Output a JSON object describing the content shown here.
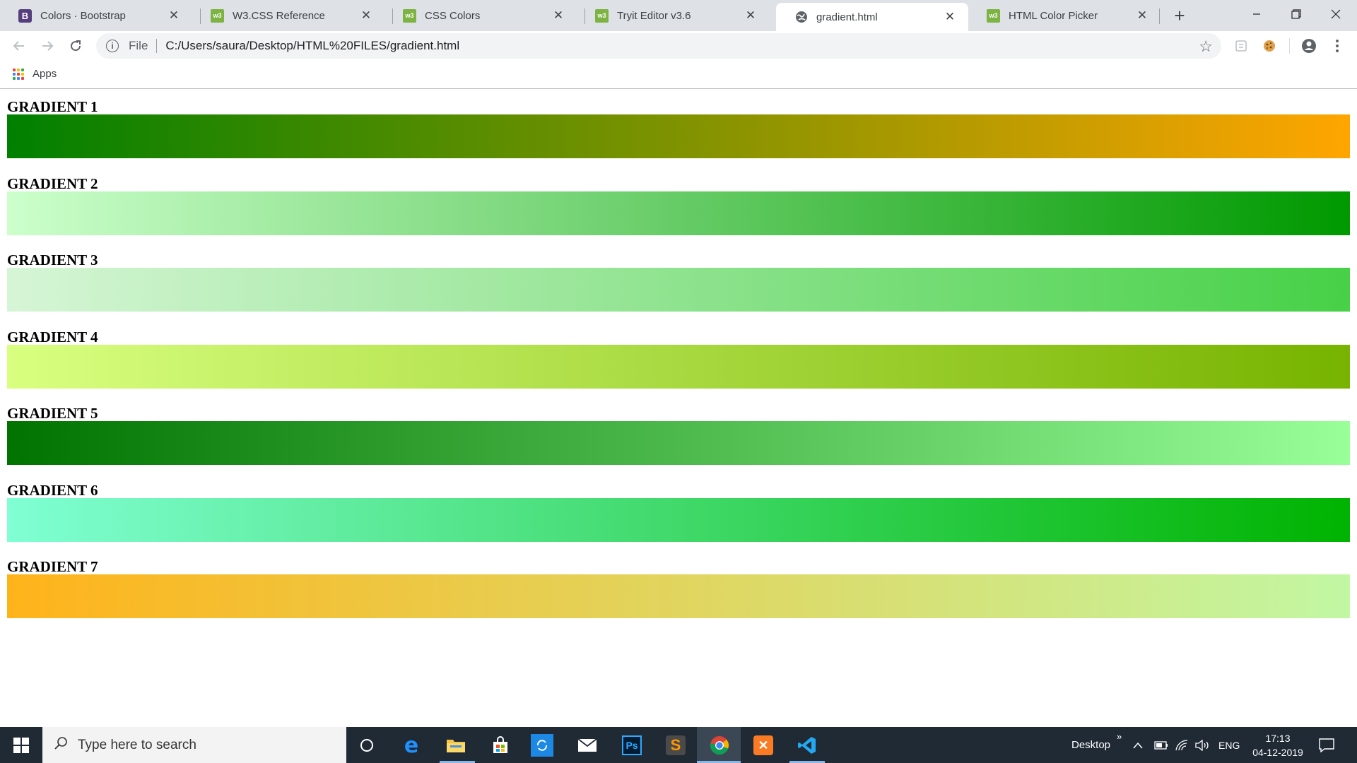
{
  "tabs": [
    {
      "label": "Colors · Bootstrap",
      "icon": "bootstrap-icon"
    },
    {
      "label": "W3.CSS Reference",
      "icon": "w3schools-icon"
    },
    {
      "label": "CSS Colors",
      "icon": "w3schools-icon"
    },
    {
      "label": "Tryit Editor v3.6",
      "icon": "w3schools-icon"
    },
    {
      "label": "gradient.html",
      "icon": "globe-icon",
      "active": true
    },
    {
      "label": "HTML Color Picker",
      "icon": "w3schools-icon"
    }
  ],
  "address_bar": {
    "scheme_label": "File",
    "url": "C:/Users/saura/Desktop/HTML%20FILES/gradient.html"
  },
  "bookmarks": {
    "apps_label": "Apps"
  },
  "gradients": [
    {
      "title": "GRADIENT 1",
      "from": "#008000",
      "to": "#ffa500"
    },
    {
      "title": "GRADIENT 2",
      "from": "#ccffcc",
      "to": "#009900"
    },
    {
      "title": "GRADIENT 3",
      "from": "#d6f5d6",
      "to": "#47d147"
    },
    {
      "title": "GRADIENT 4",
      "from": "#d9ff80",
      "to": "#77b300"
    },
    {
      "title": "GRADIENT 5",
      "from": "#007300",
      "to": "#99ff99"
    },
    {
      "title": "GRADIENT 6",
      "from": "#80ffd4",
      "to": "#00b300"
    },
    {
      "title": "GRADIENT 7",
      "from": "#ffb31a",
      "to": "#c2f7a3"
    }
  ],
  "taskbar": {
    "search_placeholder": "Type here to search",
    "desktop_label": "Desktop",
    "language": "ENG",
    "time": "17:13",
    "date": "04-12-2019"
  }
}
